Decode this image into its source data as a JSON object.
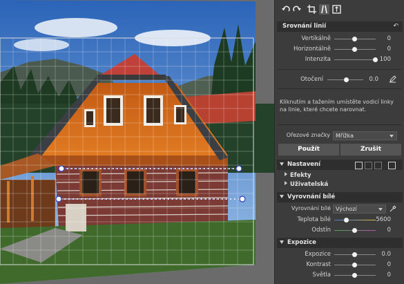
{
  "toolbar": {
    "icons": [
      "rotate-left-icon",
      "rotate-right-icon",
      "crop-icon",
      "straighten-icon",
      "perspective-icon"
    ]
  },
  "straighten_section": {
    "title": "Srovnání linií",
    "sliders": [
      {
        "label": "Vertikálně",
        "value": "0",
        "level": 0.5
      },
      {
        "label": "Horizontálně",
        "value": "0",
        "level": 0.5
      },
      {
        "label": "Intenzita",
        "value": "100",
        "level": 1.0
      }
    ],
    "rotation": {
      "label": "Otočení",
      "value": "0.0",
      "level": 0.5
    },
    "help_text": "Kliknutím a tažením umístěte vodicí linky na linie, které chcete narovnat.",
    "crop_marks": {
      "label": "Ořezové značky",
      "selected": "Mřížka"
    },
    "apply_label": "Použít",
    "cancel_label": "Zrušit"
  },
  "settings_section": {
    "title": "Nastavení",
    "items": [
      "Efekty",
      "Uživatelská"
    ]
  },
  "white_balance_section": {
    "title": "Vyrovnání bílé",
    "select": {
      "label": "Vyrovnání bílé",
      "selected": "Výchozí"
    },
    "sliders": [
      {
        "label": "Teplota bílé",
        "value": "5600",
        "level": 0.36
      },
      {
        "label": "Odstín",
        "value": "0",
        "level": 0.5
      }
    ]
  },
  "exposure_section": {
    "title": "Expozice",
    "sliders": [
      {
        "label": "Expozice",
        "value": "0.0",
        "level": 0.5
      },
      {
        "label": "Kontrast",
        "value": "0",
        "level": 0.5
      },
      {
        "label": "Světla",
        "value": "0",
        "level": 0.5
      }
    ]
  },
  "colors": {
    "panel_bg": "#3c3c3c",
    "section_header_bg": "#2e2e2e",
    "guide_line": "#ffffff",
    "guide_handle": "#2b3bd0"
  }
}
